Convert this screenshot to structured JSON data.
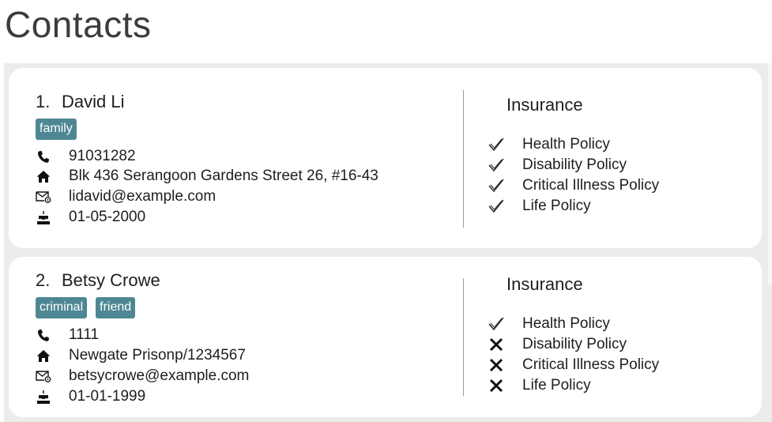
{
  "page": {
    "title": "Contacts"
  },
  "contacts": [
    {
      "index": "1.",
      "name": "David Li",
      "tags": [
        "family"
      ],
      "phone": "91031282",
      "address": "Blk 436 Serangoon Gardens Street 26, #16-43",
      "email": "lidavid@example.com",
      "birthday": "01-05-2000",
      "insurance_title": "Insurance",
      "policies": [
        {
          "label": "Health Policy",
          "status": "covered"
        },
        {
          "label": "Disability Policy",
          "status": "covered"
        },
        {
          "label": "Critical Illness Policy",
          "status": "covered"
        },
        {
          "label": "Life Policy",
          "status": "covered"
        }
      ]
    },
    {
      "index": "2.",
      "name": "Betsy Crowe",
      "tags": [
        "criminal",
        "friend"
      ],
      "phone": "1111",
      "address": "Newgate Prisonp/1234567",
      "email": "betsycrowe@example.com",
      "birthday": "01-01-1999",
      "insurance_title": "Insurance",
      "policies": [
        {
          "label": "Health Policy",
          "status": "covered"
        },
        {
          "label": "Disability Policy",
          "status": "not-covered"
        },
        {
          "label": "Critical Illness Policy",
          "status": "not-covered"
        },
        {
          "label": "Life Policy",
          "status": "not-covered"
        }
      ]
    }
  ],
  "icons": {
    "phone": "phone-icon",
    "address": "home-icon",
    "email": "email-icon",
    "birthday": "birthday-cake-icon",
    "covered": "check-icon",
    "not_covered": "cross-icon"
  },
  "colors": {
    "tag_bg": "#4e8793",
    "card_bg": "#ffffff",
    "panel_bg": "#ececec"
  }
}
